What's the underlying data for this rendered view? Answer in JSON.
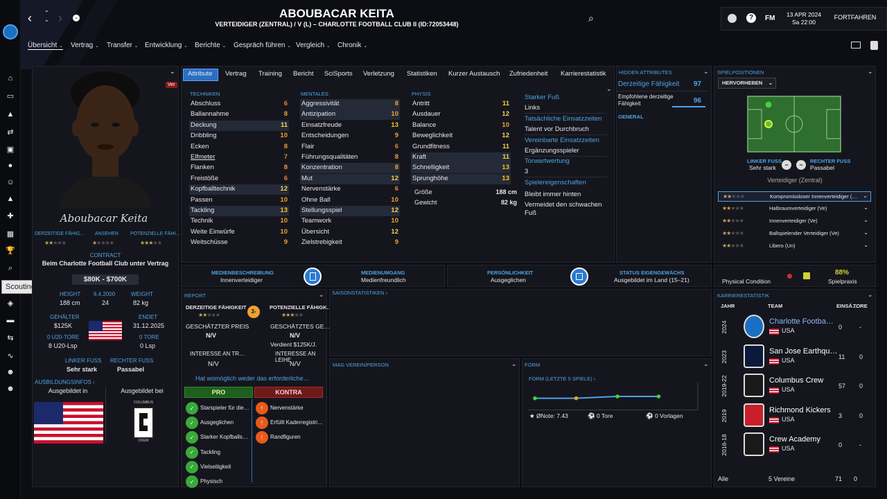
{
  "header": {
    "name": "ABOUBACAR KEITA",
    "subtitle": "VERTEIDIGER (ZENTRAL) / V (L) – CHARLOTTE FOOTBALL CLUB II (ID:72053448)",
    "date": "13 APR 2024",
    "time": "Sa 22:00",
    "continue": "FORTFAHREN",
    "fm": "FM"
  },
  "menu": [
    "Übersicht",
    "Vertrag",
    "Transfer",
    "Entwicklung",
    "Berichte",
    "Gespräch führen",
    "Vergleich",
    "Chronik"
  ],
  "tooltip": "Scouting",
  "tabs": [
    "Attribute",
    "Vertrag",
    "Training",
    "Bericht",
    "SciSports",
    "Verletzung",
    "Statistiken",
    "Kurzer Austausch",
    "Zufriedenheit",
    "Karrierestatistik"
  ],
  "left": {
    "ver": "Ver",
    "signature": "Aboubacar Keita",
    "ability_labels": [
      "DERZEITIGE FÄHIG…",
      "ANSEHEN",
      "POTENZIELLE FÄHI…"
    ],
    "contract_h": "CONTRACT",
    "contract": "Beim Charlotte Football Club unter Vertrag",
    "value": "$80K - $700K",
    "height_h": "HEIGHT",
    "height": "188 cm",
    "dob_h": "6.4.2000",
    "age": "24",
    "weight_h": "WEIGHT",
    "weight": "82 kg",
    "wages_h": "GEHÄLTER",
    "wages": "$125K",
    "ends_h": "ENDET",
    "ends": "31.12.2025",
    "u20g_h": "0 U20-TORE",
    "u20g": "8 U20-Lsp",
    "goals_h": "0 TORE",
    "goals": "0 Lsp",
    "lf_h": "LINKER FUSS",
    "lf": "Sehr stark",
    "rf_h": "RECHTER FUSS",
    "rf": "Passabel",
    "training_h": "AUSBILDUNGSINFOS",
    "trained_in": "Ausgebildet in",
    "trained_at": "Ausgebildet bei",
    "crew": "CREW",
    "columbus": "COLUMBUS"
  },
  "attr": {
    "tech_h": "TECHNIKEN",
    "ment_h": "MENTALES",
    "phys_h": "PHYSIS",
    "tech": [
      [
        "Abschluss",
        "6"
      ],
      [
        "Ballannahme",
        "8"
      ],
      [
        "Deckung",
        "11"
      ],
      [
        "Dribbling",
        "10"
      ],
      [
        "Ecken",
        "8"
      ],
      [
        "Elfmeter",
        "7"
      ],
      [
        "Flanken",
        "8"
      ],
      [
        "Freistöße",
        "6"
      ],
      [
        "Kopfballtechnik",
        "12"
      ],
      [
        "Passen",
        "10"
      ],
      [
        "Tackling",
        "13"
      ],
      [
        "Technik",
        "10"
      ],
      [
        "Weite Einwürfe",
        "10"
      ],
      [
        "Weitschüsse",
        "9"
      ]
    ],
    "ment": [
      [
        "Aggressivität",
        "8"
      ],
      [
        "Antizipation",
        "10"
      ],
      [
        "Einsatzfreude",
        "13"
      ],
      [
        "Entscheidungen",
        "9"
      ],
      [
        "Flair",
        "6"
      ],
      [
        "Führungsqualitäten",
        "8"
      ],
      [
        "Konzentration",
        "8"
      ],
      [
        "Mut",
        "12"
      ],
      [
        "Nervenstärke",
        "6"
      ],
      [
        "Ohne Ball",
        "10"
      ],
      [
        "Stellungsspiel",
        "12"
      ],
      [
        "Teamwork",
        "10"
      ],
      [
        "Übersicht",
        "12"
      ],
      [
        "Zielstrebigkeit",
        "9"
      ]
    ],
    "phys": [
      [
        "Antritt",
        "11"
      ],
      [
        "Ausdauer",
        "12"
      ],
      [
        "Balance",
        "10"
      ],
      [
        "Beweglichkeit",
        "12"
      ],
      [
        "Grundfitness",
        "11"
      ],
      [
        "Kraft",
        "11"
      ],
      [
        "Schnelligkeit",
        "13"
      ],
      [
        "Sprunghöhe",
        "13"
      ]
    ],
    "size_l": "Größe",
    "size": "188 cm",
    "weight_l": "Gewicht",
    "weight": "82 kg",
    "info": [
      [
        "Starker Fuß",
        "Links"
      ],
      [
        "Tatsächliche Einsatzzeiten",
        "Talent vor Durchbruch"
      ],
      [
        "Vereinbarte Einsatzzeiten",
        "Ergänzungsspieler"
      ],
      [
        "Torwartwertung",
        "3"
      ]
    ],
    "traits_h": "Spielereigenschaften",
    "traits": [
      "Bleibt immer hinten",
      "Vermeidet den schwachen Fuß"
    ]
  },
  "hidden": {
    "h": "HIDDEN ATTRIBUTES",
    "ca_l": "Derzeitige Fähigkeit",
    "ca": "97",
    "rca_l": "Empfohlene derzeitige Fähigkeit",
    "rca": "96",
    "general": "GENERAL"
  },
  "positions": {
    "h": "SPIELPOSITIONEN",
    "select": "HERVORHEBEN",
    "lf_h": "LINKER FUSS",
    "lf": "Sehr stark",
    "rf_h": "RECHTER FUSS",
    "rf": "Passabel",
    "pos": "Verteidiger (Zentral)",
    "roles": [
      "Kompromissloser Innenverteidiger (…",
      "Halbraumverteidiger (Ve)",
      "Innenverteidiger (Ve)",
      "Ballspielender Verteidiger (Ve)",
      "Libero (Un)"
    ]
  },
  "media": [
    {
      "h": "MEDIENBESCHREIBUNG",
      "v": "Innenverteidiger"
    },
    {
      "h": "MEDIENUMGANG",
      "v": "Medienfreundlich"
    },
    {
      "h": "PERSÖNLICHKEIT",
      "v": "Ausgeglichen"
    },
    {
      "h": "STATUS EIGENGEWÄCHS",
      "v": "Ausgebildet im Land (15–21)"
    }
  ],
  "condition": {
    "l": "Physical Condition",
    "pct": "88%",
    "l2": "Spielpraxis"
  },
  "report": {
    "h": "REPORT",
    "ca": "DERZEITIGE FÄHIGKEIT",
    "pa": "POTENZIELLE FÄHIGK…",
    "badge": "3-",
    "price_l": "GESCHÄTZTER PREIS",
    "price": "N/V",
    "value_l": "GESCHÄTZTES GE…",
    "value": "N/V",
    "wage": "Verdient $125K/J.",
    "int1_l": "INTERESSE AN TR…",
    "int1": "N/V",
    "int2_l": "INTERESSE AN LEIHE",
    "int2": "N/V",
    "hint": "Hat womöglich weder das erforderliche…",
    "pro": "PRO",
    "contra": "KONTRA",
    "pros": [
      "Starspieler für die…",
      "Ausgeglichen",
      "Starker Kopfballs…",
      "Tackling",
      "Vielseitigkeit",
      "Physisch"
    ],
    "cons": [
      "Nervenstärke",
      "Erfüllt Kaderregistri…",
      "Randfiguren"
    ]
  },
  "season": {
    "h": "SAISONSTATISTIKEN"
  },
  "likes": {
    "h": "MAG VEREIN/PERSON"
  },
  "form": {
    "h": "FORM",
    "sub": "FORM (LETZTE 5 SPIELE)",
    "rating": "ØNote: 7.43",
    "goals": "0 Tore",
    "assists": "0 Vorlagen"
  },
  "career": {
    "h": "KARRIERESTATISTIK",
    "cols": [
      "JAHR",
      "TEAM",
      "EINSÄ…",
      "TORE"
    ],
    "rows": [
      [
        "2024",
        "Charlotte Footba…",
        "USA",
        "0",
        "-"
      ],
      [
        "2023",
        "San Jose Earthqu…",
        "USA",
        "11",
        "0"
      ],
      [
        "2019-22",
        "Columbus Crew",
        "USA",
        "57",
        "0"
      ],
      [
        "2019",
        "Richmond Kickers",
        "USA",
        "3",
        "0"
      ],
      [
        "2016-18",
        "Crew Academy",
        "USA",
        "0",
        "-"
      ]
    ],
    "total_l": "Alle",
    "total_t": "5 Vereine",
    "total_a": "71",
    "total_g": "0"
  },
  "chart_data": {
    "type": "line",
    "title": "FORM (LETZTE 5 SPIELE)",
    "values": [
      7.3,
      7.3,
      7.5,
      7.5,
      7.5
    ]
  }
}
